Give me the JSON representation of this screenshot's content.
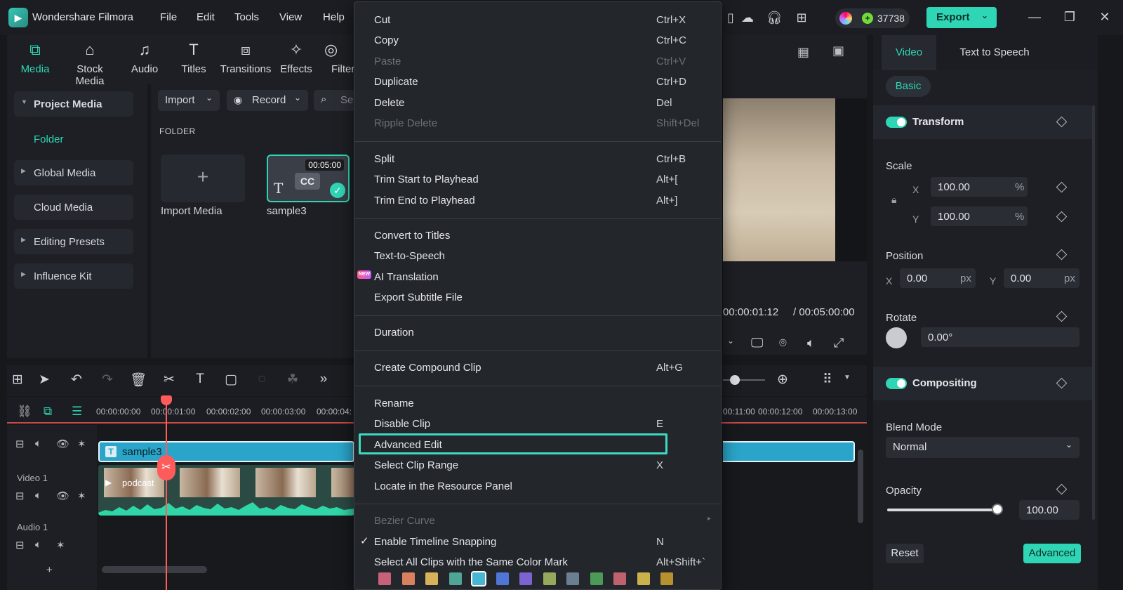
{
  "app": {
    "name": "Wondershare Filmora",
    "menus": [
      "File",
      "Edit",
      "Tools",
      "View",
      "Help"
    ],
    "credits": "37738",
    "export_label": "Export"
  },
  "media_toolbar": {
    "items": [
      "Media",
      "Stock Media",
      "Audio",
      "Titles",
      "Transitions",
      "Effects",
      "Filters"
    ]
  },
  "sidebar": {
    "project_media": "Project Media",
    "folder": "Folder",
    "items": [
      "Global Media",
      "Cloud Media",
      "Editing Presets",
      "Influence Kit"
    ]
  },
  "media_panel": {
    "import_dropdown": "Import",
    "record_dropdown": "Record",
    "search_placeholder": "Se",
    "folder_heading": "FOLDER",
    "import_media_label": "Import Media",
    "clip_name": "sample3",
    "clip_duration": "00:05:00",
    "clip_cc": "CC"
  },
  "preview": {
    "current_time": "00:00:01:12",
    "total_time": "/  00:05:00:00"
  },
  "timeline": {
    "ruler": [
      "00:00:00:00",
      "00:00:01:00",
      "00:00:02:00",
      "00:00:03:00",
      "00:00:04:",
      "00:11:00",
      "00:00:12:00",
      "00:00:13:00"
    ],
    "track_video": "Video 1",
    "track_audio": "Audio 1",
    "title_clip": "sample3",
    "video_clip": "podcast"
  },
  "context_menu": {
    "items": [
      {
        "label": "Cut",
        "shortcut": "Ctrl+X",
        "disabled": false
      },
      {
        "label": "Copy",
        "shortcut": "Ctrl+C",
        "disabled": false
      },
      {
        "label": "Paste",
        "shortcut": "Ctrl+V",
        "disabled": true
      },
      {
        "label": "Duplicate",
        "shortcut": "Ctrl+D",
        "disabled": false
      },
      {
        "label": "Delete",
        "shortcut": "Del",
        "disabled": false
      },
      {
        "label": "Ripple Delete",
        "shortcut": "Shift+Del",
        "disabled": true
      },
      {
        "label": "Split",
        "shortcut": "Ctrl+B",
        "disabled": false
      },
      {
        "label": "Trim Start to Playhead",
        "shortcut": "Alt+[",
        "disabled": false
      },
      {
        "label": "Trim End to Playhead",
        "shortcut": "Alt+]",
        "disabled": false
      },
      {
        "label": "Convert to Titles",
        "shortcut": "",
        "disabled": false
      },
      {
        "label": "Text-to-Speech",
        "shortcut": "",
        "disabled": false
      },
      {
        "label": "AI Translation",
        "shortcut": "",
        "disabled": false
      },
      {
        "label": "Export Subtitle File",
        "shortcut": "",
        "disabled": false
      },
      {
        "label": "Duration",
        "shortcut": "",
        "disabled": false
      },
      {
        "label": "Create Compound Clip",
        "shortcut": "Alt+G",
        "disabled": false
      },
      {
        "label": "Rename",
        "shortcut": "",
        "disabled": false
      },
      {
        "label": "Disable Clip",
        "shortcut": "E",
        "disabled": false
      },
      {
        "label": "Advanced Edit",
        "shortcut": "",
        "disabled": false
      },
      {
        "label": "Select Clip Range",
        "shortcut": "X",
        "disabled": false
      },
      {
        "label": "Locate in the Resource Panel",
        "shortcut": "",
        "disabled": false
      },
      {
        "label": "Bezier Curve",
        "shortcut": "",
        "disabled": true
      },
      {
        "label": "Enable Timeline Snapping",
        "shortcut": "N",
        "disabled": false
      },
      {
        "label": "Select All Clips with the Same Color Mark",
        "shortcut": "Alt+Shift+`",
        "disabled": false
      }
    ],
    "new_badge": "NEW",
    "swatch_colors": [
      "#c8617a",
      "#d9805e",
      "#d8b25a",
      "#4fa596",
      "#47b7d1",
      "#4f76d6",
      "#7b63d0",
      "#95a85c",
      "#6c7f91",
      "#4c9a58",
      "#c0616e",
      "#c9b24b",
      "#b8912f"
    ]
  },
  "properties": {
    "tab_video": "Video",
    "tab_tts": "Text to Speech",
    "basic": "Basic",
    "transform": "Transform",
    "scale": "Scale",
    "scale_x": "100.00",
    "scale_y": "100.00",
    "percent": "%",
    "position": "Position",
    "pos_x": "0.00",
    "pos_y": "0.00",
    "px": "px",
    "x_axis": "X",
    "y_axis": "Y",
    "rotate": "Rotate",
    "rotate_value": "0.00°",
    "compositing": "Compositing",
    "blend_mode": "Blend Mode",
    "blend_value": "Normal",
    "opacity": "Opacity",
    "opacity_value": "100.00",
    "opacity_level": 1.0,
    "reset": "Reset",
    "advanced": "Advanced"
  }
}
